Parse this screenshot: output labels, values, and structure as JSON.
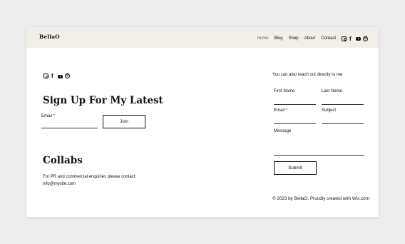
{
  "header": {
    "logo": "BellaO",
    "nav": [
      "Home",
      "Blog",
      "Shop",
      "About",
      "Contact"
    ],
    "active_nav": "Home",
    "social_icons": [
      "instagram-icon",
      "facebook-icon",
      "youtube-icon",
      "pinterest-icon"
    ]
  },
  "left": {
    "social_icons": [
      "instagram-icon",
      "facebook-icon",
      "youtube-icon",
      "pinterest-icon"
    ],
    "signup_title": "Sign Up For My Latest",
    "email_label": "Email *",
    "join_label": "Join",
    "collabs_title": "Collabs",
    "collabs_text_1": "For PR and commercial enquiries please contact:",
    "collabs_text_2": "info@mysite.com"
  },
  "right": {
    "intro": "You can also reach out directly to me",
    "first_name_label": "First Name",
    "last_name_label": "Last Name",
    "email_label": "Email *",
    "subject_label": "Subject",
    "message_label": "Message",
    "submit_label": "Submit",
    "footer": "© 2023 by BellaO. Proudly created with Wix.com"
  },
  "colors": {
    "header_bg": "#f1efe8",
    "active_nav": "#6b6a3a",
    "page_bg": "#ededed"
  }
}
